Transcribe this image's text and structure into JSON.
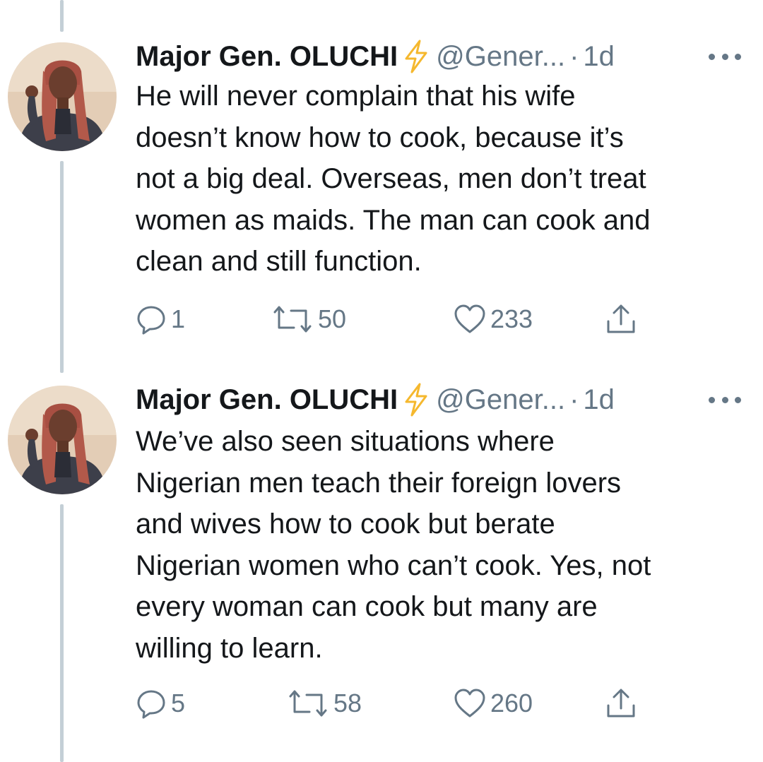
{
  "tweets": [
    {
      "display_name": "Major Gen. OLUCHI",
      "badge_icon": "lightning-bolt-icon",
      "handle": "@Gener...",
      "separator": "·",
      "time": "1d",
      "more_icon": "more-dots-icon",
      "text_lines": [
        "He will never complain that his wife",
        "doesn’t know how to cook, because it’s",
        "not a big deal. Overseas, men don’t treat",
        "women as maids. The man can cook and",
        "clean and still function."
      ],
      "replies": "1",
      "retweets": "50",
      "likes": "233"
    },
    {
      "display_name": "Major Gen. OLUCHI",
      "badge_icon": "lightning-bolt-icon",
      "handle": "@Gener...",
      "separator": "·",
      "time": "1d",
      "more_icon": "more-dots-icon",
      "text_lines": [
        "We’ve also seen situations where",
        "Nigerian men teach their foreign lovers",
        "and wives how to cook but berate",
        "Nigerian women who can’t cook. Yes, not",
        "every woman can cook but many are",
        "willing to learn."
      ],
      "replies": "5",
      "retweets": "58",
      "likes": "260"
    }
  ],
  "colors": {
    "text": "#14171a",
    "secondary": "#657786",
    "thread_line": "#c4cfd6",
    "bolt": "#f5b82e"
  }
}
